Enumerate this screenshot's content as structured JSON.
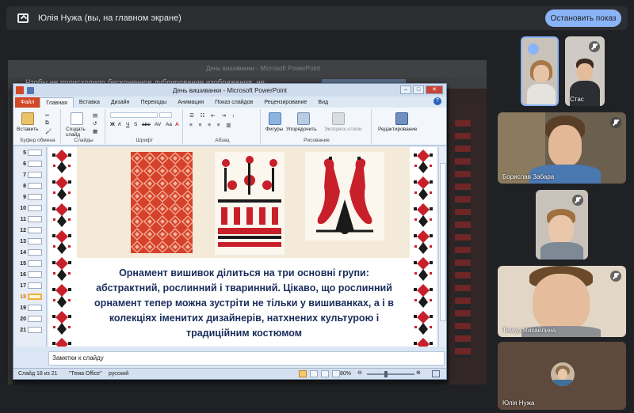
{
  "meet": {
    "title": "Юлія Нужа (вы, на главном экране)",
    "stop_button": "Остановить показ"
  },
  "background_window": {
    "title": "День вишиванки - Microsoft PowerPoint",
    "partial_text": "Чтобы не происходило бесконечное дублирование изображения, не"
  },
  "powerpoint": {
    "window_title": "День вишиванки - Microsoft PowerPoint",
    "tabs": [
      "Файл",
      "Главная",
      "Вставка",
      "Дизайн",
      "Переходы",
      "Анимация",
      "Показ слайдов",
      "Рецензирование",
      "Вид"
    ],
    "active_tab": "Главная",
    "ribbon_groups": {
      "clipboard": {
        "label": "Буфер обмена",
        "paste": "Вставить"
      },
      "slides": {
        "label": "Слайды",
        "new_slide": "Создать слайд"
      },
      "font": {
        "label": "Шрифт"
      },
      "paragraph": {
        "label": "Абзац"
      },
      "drawing": {
        "label": "Рисование",
        "shapes": "Фигуры",
        "arrange": "Упорядочить",
        "quick_styles": "Экспресс-стили"
      },
      "editing": {
        "label": "Редактирование"
      }
    },
    "font_buttons": [
      "Ж",
      "К",
      "Ч",
      "S",
      "abe",
      "AV",
      "Aa",
      "A"
    ],
    "thumbnail_numbers": [
      "5",
      "6",
      "7",
      "8",
      "9",
      "10",
      "11",
      "12",
      "13",
      "14",
      "15",
      "16",
      "17",
      "18",
      "19",
      "20",
      "21"
    ],
    "selected_slide": "18",
    "slide_text": "Орнамент вишивок ділиться на три основні групи: абстрактний, рослинний і тваринний. Цікаво, що рослинний орнамент  тепер можна зустріти не тільки у вишиванках, а і в колекціях іменитих дизайнерів, натхнених культурою і традиційним костюмом",
    "notes_placeholder": "Заметки к слайду",
    "status": {
      "slide": "Слайд 18 из 21",
      "theme": "\"Тема Office\"",
      "language": "русский",
      "zoom": "80%"
    },
    "colors": {
      "embroidery_red": "#c8202a",
      "embroidery_black": "#1a1a1a",
      "ribbon": "#f3f7fc"
    }
  },
  "participants": [
    {
      "name": "",
      "muted": false,
      "has_menu": true
    },
    {
      "name": "Стас",
      "muted": true
    },
    {
      "name": "Борислав Забара",
      "muted": true
    },
    {
      "name": "",
      "muted": true
    },
    {
      "name": "Тимур Михайлина",
      "muted": true
    },
    {
      "name": "Юлія Нужа",
      "muted": false
    }
  ]
}
